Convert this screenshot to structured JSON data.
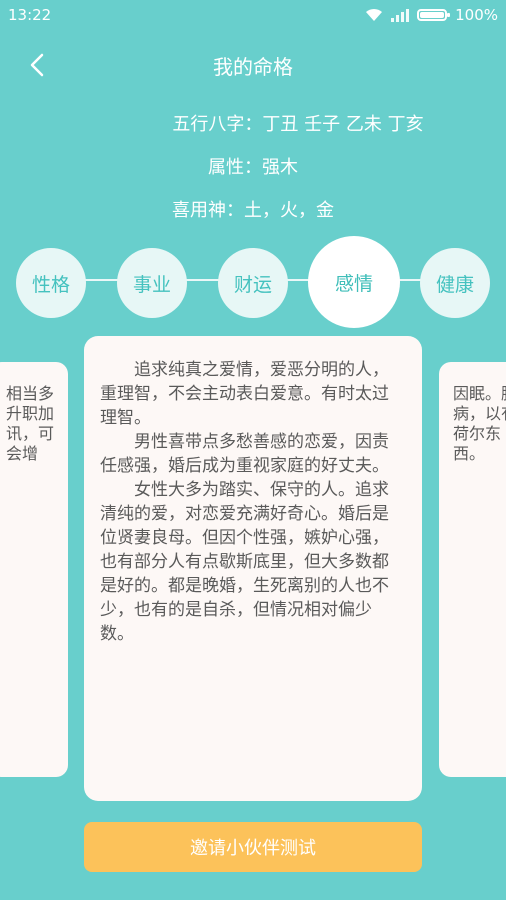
{
  "status": {
    "time": "13:22",
    "battery": "100%"
  },
  "header": {
    "title": "我的命格"
  },
  "info": {
    "bazi": "五行八字：丁丑 壬子 乙未 丁亥",
    "attribute": "属性：强木",
    "favorable": "喜用神：土，火，金"
  },
  "tabs": [
    {
      "label": "性格"
    },
    {
      "label": "事业"
    },
    {
      "label": "财运"
    },
    {
      "label": "感情"
    },
    {
      "label": "健康"
    }
  ],
  "card": {
    "paragraphs": [
      "追求纯真之爱情，爱恶分明的人，重理智，不会主动表白爱意。有时太过理智。",
      "男性喜带点多愁善感的恋爱，因责任感强，婚后成为重视家庭的好丈夫。",
      "女性大多为踏实、保守的人。追求清纯的爱，对恋爱充满好奇心。婚后是位贤妻良母。但因个性强，嫉妒心强，也有部分人有点歇斯底里，但大多数都是好的。都是晚婚，生死离别的人也不少，也有的是自杀，但情况相对偏少数。"
    ]
  },
  "side_left": {
    "text": "相当多升职加讯，可会增"
  },
  "side_right": {
    "text": "因眠。豚病，以有荷尔东西。"
  },
  "button": {
    "invite": "邀请小伙伴测试"
  },
  "colors": {
    "background": "#68cfcc",
    "tab_text": "#45c2bf",
    "button": "#fcc25a",
    "card": "#fdf8f6"
  }
}
